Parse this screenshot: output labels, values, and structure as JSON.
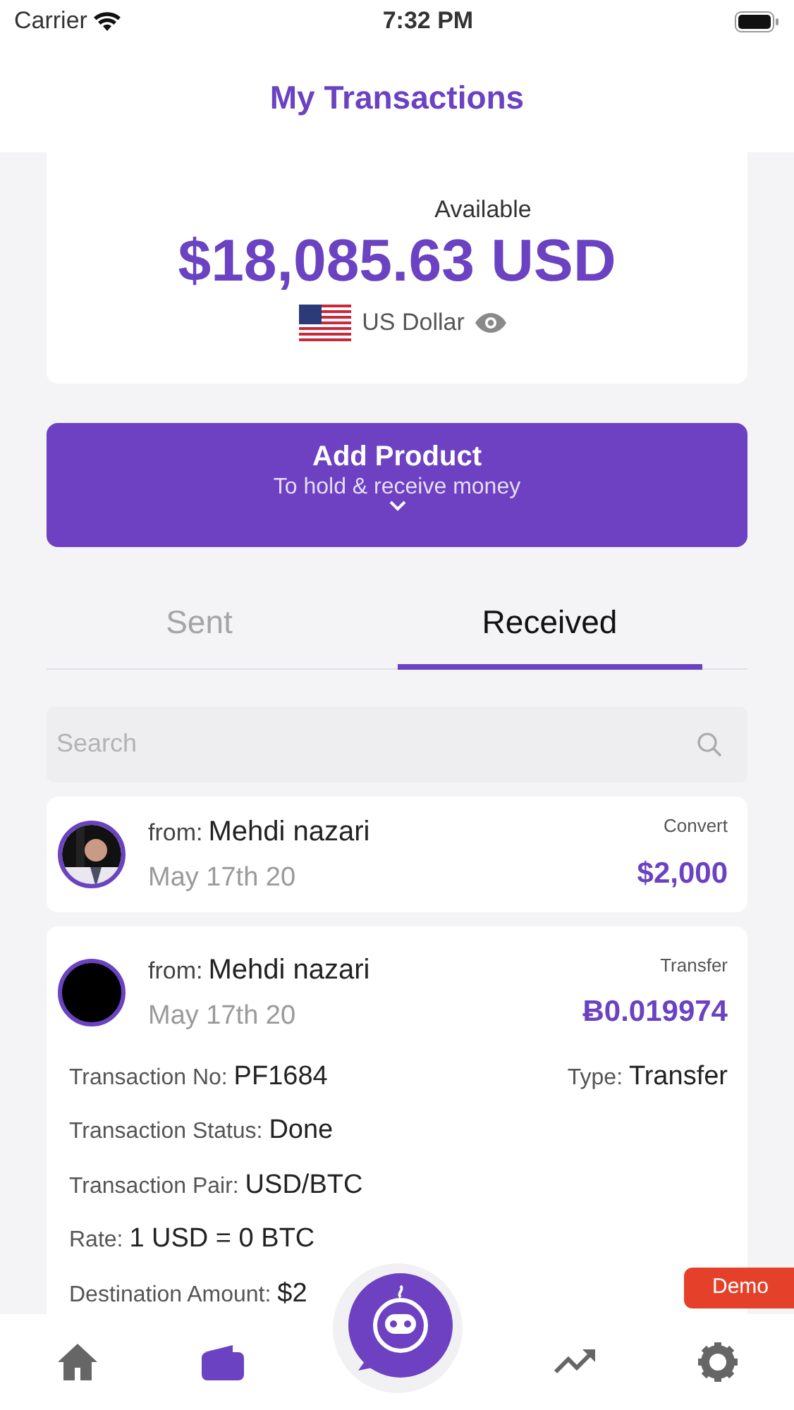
{
  "status_bar": {
    "carrier": "Carrier",
    "time": "7:32 PM"
  },
  "header": {
    "title": "My Transactions"
  },
  "balance": {
    "label": "Available",
    "amount": "$18,085.63 USD",
    "currency": "US Dollar"
  },
  "add_product": {
    "title": "Add Product",
    "subtitle": "To hold & receive money"
  },
  "tabs": [
    {
      "label": "Sent",
      "selected": false
    },
    {
      "label": "Received",
      "selected": true
    }
  ],
  "search": {
    "placeholder": "Search"
  },
  "transactions": [
    {
      "from_label": "from:",
      "name": "Mehdi nazari",
      "date": "May 17th 20",
      "type": "Convert",
      "amount": "$2,000",
      "expanded": false
    },
    {
      "kind": "blank",
      "from_label": "from:",
      "name": "Mehdi nazari",
      "date": "May 17th 20",
      "type": "Transfer",
      "amount": "Ƀ0.019974",
      "expanded": true,
      "details": [
        [
          {
            "label": "Transaction No:",
            "value": "PF1684"
          },
          {
            "label": "Type:",
            "value": "Transfer"
          }
        ],
        [
          {
            "label": "Transaction Status:",
            "value": "Done"
          }
        ],
        [
          {
            "label": "Transaction Pair:",
            "value": "USD/BTC"
          }
        ],
        [
          {
            "label": "Rate:",
            "value": "1 USD = 0 BTC"
          }
        ],
        [
          {
            "label": "Destination Amount:",
            "value": "$2"
          }
        ]
      ]
    }
  ],
  "nav": [
    {
      "kind": "home",
      "selected": false
    },
    {
      "kind": "wallet",
      "selected": true
    },
    {
      "kind": "assistant",
      "selected": false
    },
    {
      "kind": "chart",
      "selected": false
    },
    {
      "kind": "settings",
      "selected": false
    }
  ],
  "demo_badge": "Demo"
}
